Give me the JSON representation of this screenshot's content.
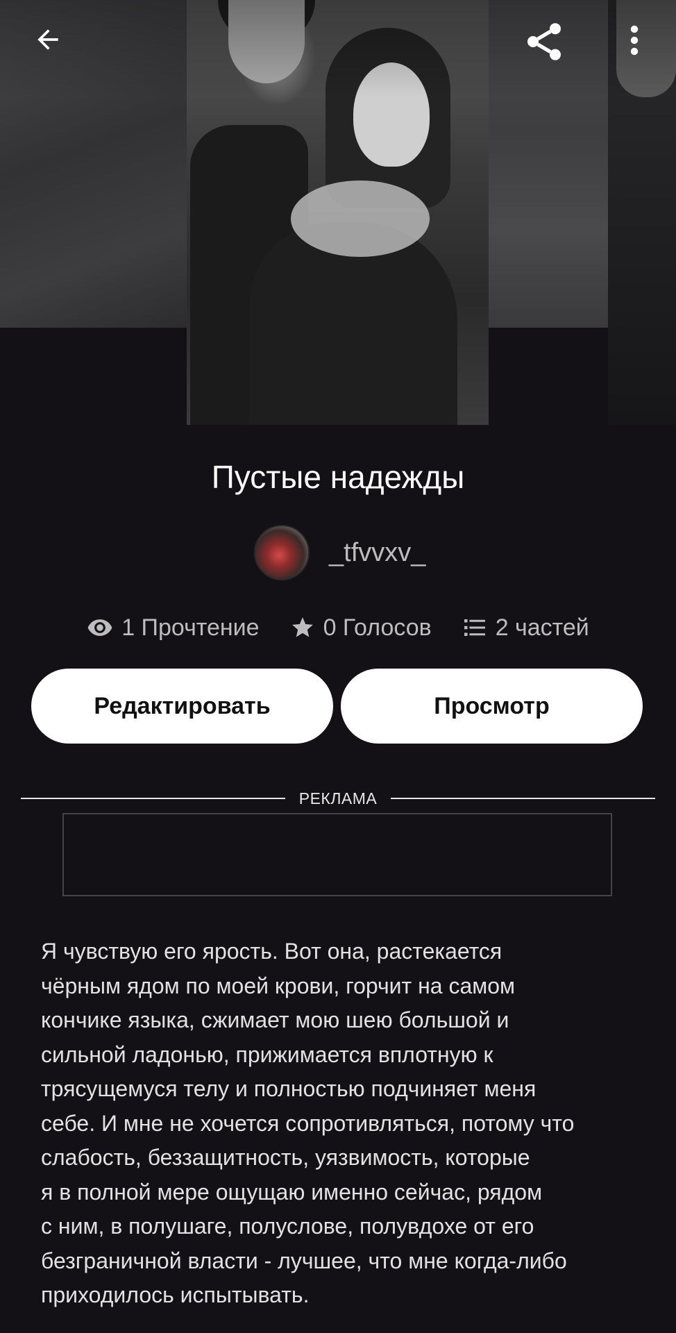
{
  "header": {
    "back_icon": "arrow-left-icon",
    "share_icon": "share-icon",
    "more_icon": "more-vertical-icon"
  },
  "story": {
    "title": "Пустые надежды",
    "author": "_tfvvxv_",
    "stats": {
      "reads": "1 Прочтение",
      "votes": "0 Голосов",
      "parts": "2 частей"
    }
  },
  "actions": {
    "edit_label": "Редактировать",
    "view_label": "Просмотр"
  },
  "ad": {
    "label": "РЕКЛАМА"
  },
  "description": "Я чувствую его ярость. Вот она, растекается\nчёрным ядом по моей крови, горчит на самом\nкончике языка, сжимает мою шею большой и\nсильной ладонью, прижимается вплотную к\nтрясущемуся телу и полностью подчиняет меня\nсебе. И мне не хочется сопротивляться, потому что\nслабость, беззащитность, уязвимость, которые\nя в полной мере ощущаю именно сейчас, рядом\nс ним, в полушаге, полуслове, полувдохе от его\nбезграничной власти - лучшее, что мне когда-либо\nприходилось испытывать.",
  "colors": {
    "background": "#131115",
    "button_bg": "#ffffff",
    "muted_text": "#bdbdbd"
  }
}
